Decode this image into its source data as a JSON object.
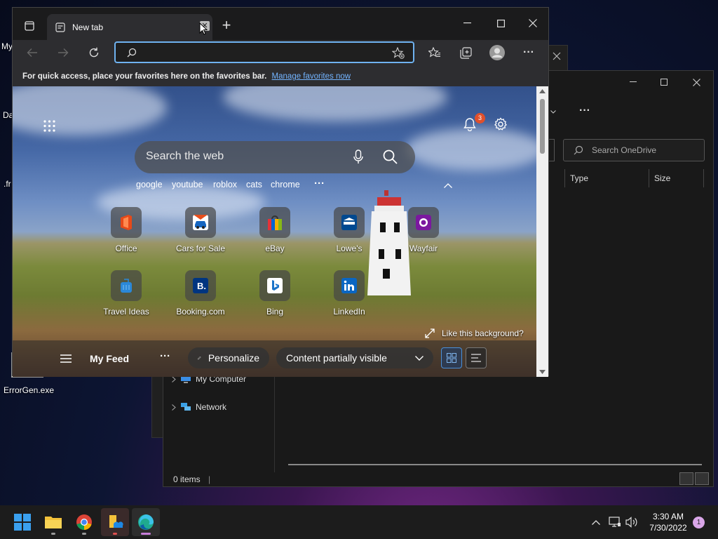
{
  "desktop": {
    "labels": [
      "My",
      "Da",
      ".fr",
      "ErrorGen.exe"
    ]
  },
  "browser": {
    "tab_title": "New tab",
    "tab_close_glyph": "✕",
    "new_tab_glyph": "+",
    "window_controls": {
      "minimize": "—",
      "maximize": "☐",
      "close": "✕"
    },
    "more_glyph": "···",
    "address_placeholder": "",
    "favorites_bar": {
      "text": "For quick access, place your favorites here on the favorites bar.",
      "link": "Manage favorites now"
    },
    "newtab": {
      "notification_count": "3",
      "search_placeholder": "Search the web",
      "suggestions": [
        "google",
        "youtube",
        "roblox",
        "cats",
        "chrome"
      ],
      "suggestions_more": "···",
      "tiles": [
        {
          "label": "Office"
        },
        {
          "label": "Cars for Sale"
        },
        {
          "label": "eBay"
        },
        {
          "label": "Lowe's"
        },
        {
          "label": "Wayfair"
        },
        {
          "label": "Travel Ideas"
        },
        {
          "label": "Booking.com"
        },
        {
          "label": "Bing"
        },
        {
          "label": "LinkedIn"
        }
      ],
      "like_background": "Like this background?",
      "feed": {
        "title": "My Feed",
        "more": "···",
        "personalize": "Personalize",
        "visibility": "Content partially visible"
      }
    }
  },
  "explorer": {
    "more_glyph": "···",
    "search_placeholder": "Search OneDrive",
    "columns": [
      "Type",
      "Size"
    ],
    "nav_items": [
      "My Computer",
      "Network"
    ],
    "status": "0 items"
  },
  "taskbar": {
    "time": "3:30 AM",
    "date": "7/30/2022",
    "notification_badge": "1"
  }
}
